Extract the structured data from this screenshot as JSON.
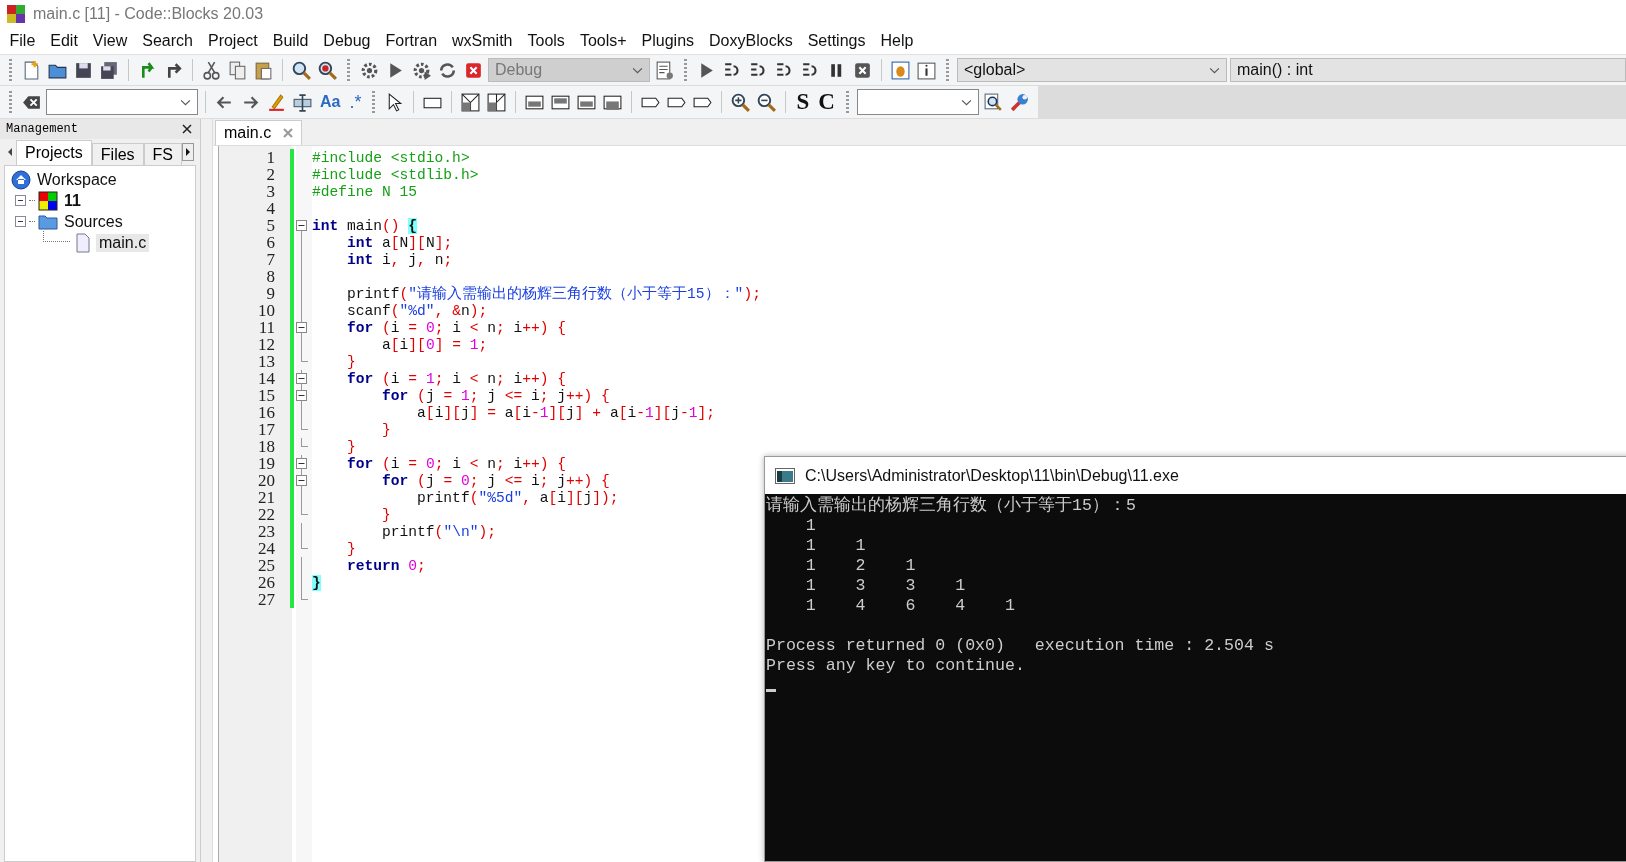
{
  "window": {
    "title": "main.c [11] - Code::Blocks 20.03"
  },
  "menu": [
    "File",
    "Edit",
    "View",
    "Search",
    "Project",
    "Build",
    "Debug",
    "Fortran",
    "wxSmith",
    "Tools",
    "Tools+",
    "Plugins",
    "DoxyBlocks",
    "Settings",
    "Help"
  ],
  "toolbar": {
    "build_target": {
      "value": "Debug",
      "disabled": true
    },
    "scope": {
      "value": "<global>"
    },
    "function": {
      "value": "main() : int"
    },
    "match_case_label": "Aa",
    "regex_label": ".*",
    "s_label": "S",
    "c_label": "C"
  },
  "management": {
    "title": "Management",
    "tabs": [
      {
        "label": "Projects",
        "selected": true
      },
      {
        "label": "Files",
        "selected": false
      },
      {
        "label": "FS",
        "selected": false
      }
    ],
    "tree": [
      {
        "label": "Workspace",
        "kind": "workspace",
        "selected": false,
        "expanded": true,
        "children": [
          {
            "label": "11",
            "kind": "project",
            "selected": false,
            "expanded": true,
            "children": [
              {
                "label": "Sources",
                "kind": "folder",
                "selected": false,
                "expanded": true,
                "children": [
                  {
                    "label": "main.c",
                    "kind": "file",
                    "selected": true
                  }
                ]
              }
            ]
          }
        ]
      }
    ]
  },
  "editor": {
    "tabs": [
      {
        "label": "main.c",
        "selected": true
      }
    ],
    "lines": [
      {
        "n": "1",
        "text": "#include <stdio.h>"
      },
      {
        "n": "2",
        "text": "#include <stdlib.h>"
      },
      {
        "n": "3",
        "text": "#define N 15"
      },
      {
        "n": "4"
      },
      {
        "n": "5",
        "foldable": true,
        "brace_highlight": true,
        "text": "**int** main() {"
      },
      {
        "n": "6",
        "text": "    **int** a[N][N];"
      },
      {
        "n": "7",
        "text": "    **int** i, j, n;"
      },
      {
        "n": "8"
      },
      {
        "n": "9",
        "text": "    printf(\"请输入需输出的杨辉三角行数（小于等于15）：\");"
      },
      {
        "n": "10",
        "text": "    scanf(\"%d\", &n);"
      },
      {
        "n": "11",
        "foldable": true,
        "text": "    **for** (i = 0; i < n; i++) {"
      },
      {
        "n": "12",
        "text": "        a[i][0] = 1;"
      },
      {
        "n": "13",
        "fold_end": true,
        "text": "    }"
      },
      {
        "n": "14",
        "foldable": true,
        "text": "    **for** (i = 1; i < n; i++) {"
      },
      {
        "n": "15",
        "foldable": true,
        "text": "        **for** (j = 1; j <= i; j++) {"
      },
      {
        "n": "16",
        "text": "            a[i][j] = a[i-1][j] + a[i-1][j-1];"
      },
      {
        "n": "17",
        "fold_end": true,
        "text": "        }"
      },
      {
        "n": "18",
        "fold_end": true,
        "text": "    }"
      },
      {
        "n": "19",
        "foldable": true,
        "text": "    **for** (i = 0; i < n; i++) {"
      },
      {
        "n": "20",
        "foldable": true,
        "text": "        **for** (j = 0; j <= i; j++) {"
      },
      {
        "n": "21",
        "text": "            printf(\"%5d\", a[i][j]);"
      },
      {
        "n": "22",
        "fold_end": true,
        "text": "        }"
      },
      {
        "n": "23",
        "text": "        printf(\"\\n\");"
      },
      {
        "n": "24",
        "fold_end": true,
        "text": "    }"
      },
      {
        "n": "25",
        "text": "    **return** 0;"
      },
      {
        "n": "26",
        "brace_highlight": true,
        "text": "}"
      },
      {
        "n": "27",
        "fold_end": true
      }
    ]
  },
  "console": {
    "title": "C:\\Users\\Administrator\\Desktop\\11\\bin\\Debug\\11.exe",
    "output": [
      "请输入需输出的杨辉三角行数（小于等于15）：5",
      "    1",
      "    1    1",
      "    1    2    1",
      "    1    3    3    1",
      "    1    4    6    4    1"
    ],
    "footer": [
      "Process returned 0 (0x0)   execution time : 2.504 s",
      "Press any key to continue."
    ]
  }
}
